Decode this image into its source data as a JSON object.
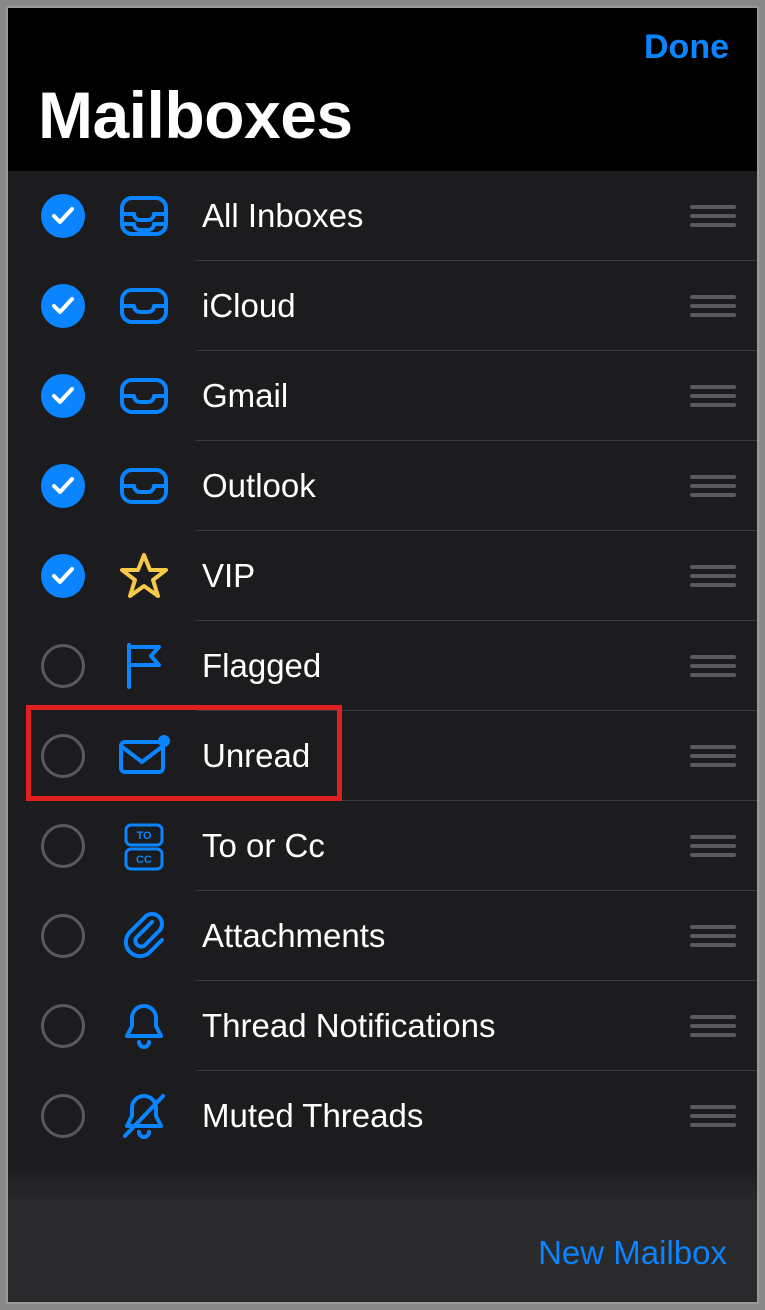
{
  "header": {
    "done_label": "Done"
  },
  "title": "Mailboxes",
  "colors": {
    "accent": "#0a84ff",
    "vip_star": "#f7c948",
    "highlight": "#e02020"
  },
  "highlighted_item_index": 6,
  "items": [
    {
      "id": "all-inboxes",
      "label": "All Inboxes",
      "checked": true,
      "icon": "inbox-stack"
    },
    {
      "id": "icloud",
      "label": "iCloud",
      "checked": true,
      "icon": "inbox"
    },
    {
      "id": "gmail",
      "label": "Gmail",
      "checked": true,
      "icon": "inbox"
    },
    {
      "id": "outlook",
      "label": "Outlook",
      "checked": true,
      "icon": "inbox"
    },
    {
      "id": "vip",
      "label": "VIP",
      "checked": true,
      "icon": "star"
    },
    {
      "id": "flagged",
      "label": "Flagged",
      "checked": false,
      "icon": "flag"
    },
    {
      "id": "unread",
      "label": "Unread",
      "checked": false,
      "icon": "envelope-dot"
    },
    {
      "id": "to-or-cc",
      "label": "To or Cc",
      "checked": false,
      "icon": "to-cc"
    },
    {
      "id": "attachments",
      "label": "Attachments",
      "checked": false,
      "icon": "paperclip"
    },
    {
      "id": "thread-notifications",
      "label": "Thread Notifications",
      "checked": false,
      "icon": "bell"
    },
    {
      "id": "muted-threads",
      "label": "Muted Threads",
      "checked": false,
      "icon": "bell-slash"
    }
  ],
  "toolbar": {
    "new_mailbox_label": "New Mailbox"
  }
}
